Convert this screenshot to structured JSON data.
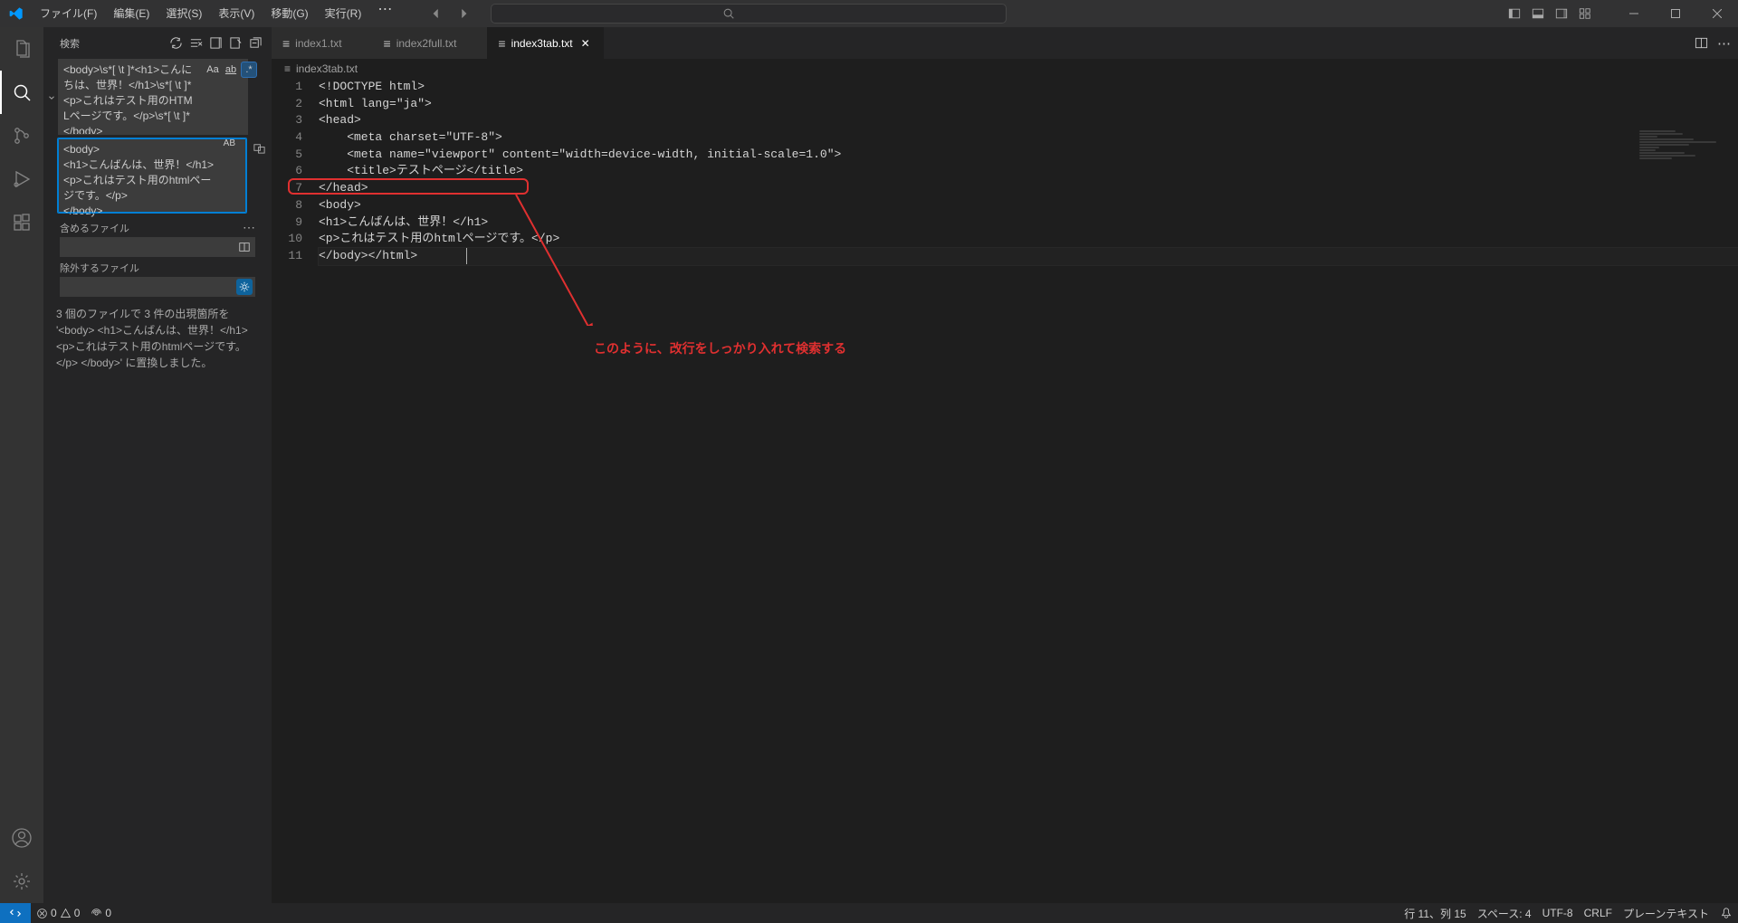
{
  "menubar": {
    "file": "ファイル(F)",
    "edit": "編集(E)",
    "select": "選択(S)",
    "view": "表示(V)",
    "go": "移動(G)",
    "run": "実行(R)"
  },
  "sidebar": {
    "title": "検索",
    "search_value": "<body>\\s*[ \\t  ]*<h1>こんにちは、世界！</h1>\\s*[ \\t  ]*<p>これはテスト用のHTMLページです。</p>\\s*[ \\t  ]*</body>",
    "replace_value": "<body>\n<h1>こんばんは、世界！</h1>\n<p>これはテスト用のhtmlページです。</p>\n</body>",
    "include_label": "含めるファイル",
    "exclude_label": "除外するファイル",
    "mod_case": "Aa",
    "mod_word": "ab",
    "mod_regex": ".*",
    "mod_preserve": "AB",
    "results_msg": "3 個のファイルで 3 件の出現箇所を '<body> <h1>こんばんは、世界！</h1> <p>これはテスト用のhtmlページです。</p> </body>' に置換しました。"
  },
  "tabs": [
    {
      "label": "index1.txt",
      "active": false
    },
    {
      "label": "index2full.txt",
      "active": false
    },
    {
      "label": "index3tab.txt",
      "active": true
    }
  ],
  "breadcrumb": "index3tab.txt",
  "editor": {
    "lines": [
      "<!DOCTYPE html>",
      "<html lang=\"ja\">",
      "<head>",
      "    <meta charset=\"UTF-8\">",
      "    <meta name=\"viewport\" content=\"width=device-width, initial-scale=1.0\">",
      "    <title>テストページ</title>",
      "</head>",
      "<body>",
      "<h1>こんばんは、世界！</h1>",
      "<p>これはテスト用のhtmlページです。</p>",
      "</body></html>"
    ]
  },
  "annotation": "このように、改行をしっかり入れて検索する",
  "status": {
    "errors": "0",
    "warnings": "0",
    "ports": "0",
    "line_col": "行 11、列 15",
    "spaces": "スペース: 4",
    "encoding": "UTF-8",
    "eol": "CRLF",
    "lang": "プレーンテキスト"
  }
}
